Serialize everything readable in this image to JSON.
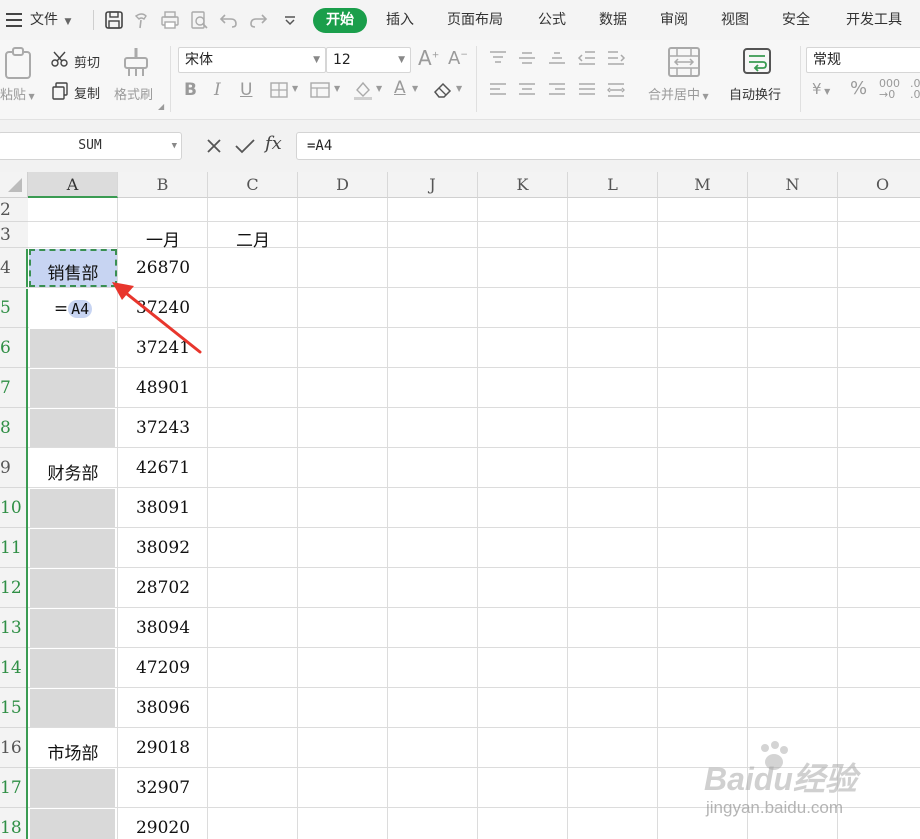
{
  "menubar": {
    "file": "文件",
    "tabs": [
      "开始",
      "插入",
      "页面布局",
      "公式",
      "数据",
      "审阅",
      "视图",
      "安全",
      "开发工具"
    ]
  },
  "ribbon": {
    "paste": "粘贴",
    "cut": "剪切",
    "copy": "复制",
    "format_painter": "格式刷",
    "font_name": "宋体",
    "font_size": "12",
    "merge_center": "合并居中",
    "wrap_text": "自动换行",
    "number_format": "常规",
    "percent": "%"
  },
  "formula_bar": {
    "name_box": "SUM",
    "fx_label": "fx",
    "formula": "=A4"
  },
  "sheet": {
    "columns": [
      "A",
      "B",
      "C",
      "D",
      "J",
      "K",
      "L",
      "M",
      "N",
      "O"
    ],
    "rows": [
      "2",
      "3",
      "4",
      "5",
      "6",
      "7",
      "8",
      "9",
      "10",
      "11",
      "12",
      "13",
      "14",
      "15",
      "16",
      "17",
      "18"
    ],
    "header_b3": "一月",
    "header_c3": "二月",
    "a4": "销售部",
    "a5_prefix": "=",
    "a5_ref": "A4",
    "a9": "财务部",
    "a16": "市场部",
    "b_values": [
      "26870",
      "37240",
      "37241",
      "48901",
      "37243",
      "42671",
      "38091",
      "38092",
      "28702",
      "38094",
      "47209",
      "38096",
      "29018",
      "32907",
      "29020"
    ]
  },
  "watermark": {
    "brand": "Baidu经验",
    "url": "jingyan.baidu.com"
  },
  "colors": {
    "accent": "#1a9e4b",
    "selection": "#c7d4f2",
    "arrow": "#e8362d",
    "blank_fill": "#d9d9d9"
  }
}
